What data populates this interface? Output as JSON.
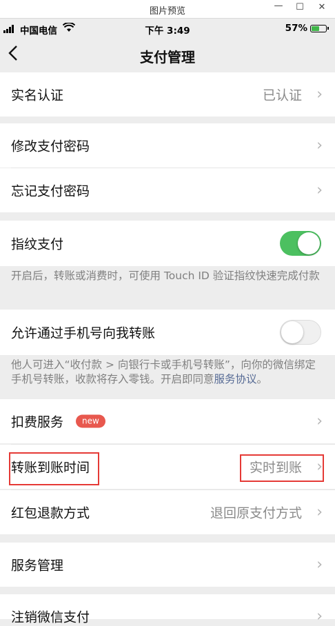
{
  "window": {
    "title": "图片预览",
    "min": "—",
    "max": "☐",
    "close": "✕"
  },
  "status_bar": {
    "carrier": "中国电信",
    "time": "下午 3:49",
    "battery": "57%",
    "battery_level": 0.57
  },
  "nav": {
    "back": "‹",
    "title": "支付管理"
  },
  "rows": {
    "real_name": {
      "label": "实名认证",
      "value": "已认证"
    },
    "change_password": {
      "label": "修改支付密码"
    },
    "forgot_password": {
      "label": "忘记支付密码"
    },
    "fingerprint": {
      "label": "指纹支付",
      "enabled": true,
      "note": "开启后，转账或消费时，可使用 Touch ID 验证指纹快速完成付款"
    },
    "phone_transfer": {
      "label": "允许通过手机号向我转账",
      "enabled": false,
      "note": "他人可进入“收付款 > 向银行卡或手机号转账”，向你的微信绑定手机号转账，收款将存入零钱。开启即同意",
      "note_link": "服务协议",
      "note_end": "。"
    },
    "deduction": {
      "label": "扣费服务",
      "badge": "new"
    },
    "arrival_time": {
      "label": "转账到账时间",
      "value": "实时到账"
    },
    "refund": {
      "label": "红包退款方式",
      "value": "退回原支付方式"
    },
    "service_mgmt": {
      "label": "服务管理"
    },
    "cancel_pay": {
      "label": "注销微信支付"
    }
  },
  "chevron": "›",
  "colors": {
    "toggle_on": "#4cc060",
    "highlight_box": "#e53935",
    "badge": "#e8584e",
    "link": "#576b95"
  }
}
